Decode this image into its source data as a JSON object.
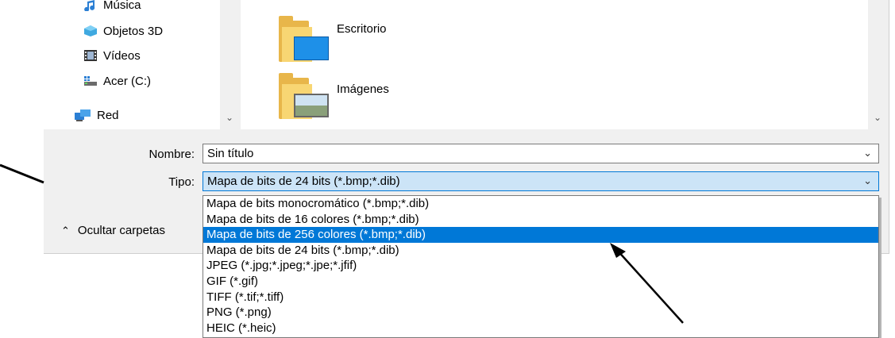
{
  "nav": {
    "items": [
      {
        "label": "Música",
        "icon": "music-icon"
      },
      {
        "label": "Objetos 3D",
        "icon": "cube-icon"
      },
      {
        "label": "Vídeos",
        "icon": "film-icon"
      },
      {
        "label": "Acer (C:)",
        "icon": "drive-icon"
      },
      {
        "label": "Red",
        "icon": "network-icon"
      }
    ]
  },
  "content": {
    "folders": [
      {
        "label": "Escritorio",
        "icon": "desktop-folder-icon"
      },
      {
        "label": "Imágenes",
        "icon": "pictures-folder-icon"
      }
    ]
  },
  "form": {
    "name_label": "Nombre:",
    "name_value": "Sin título",
    "type_label": "Tipo:",
    "type_value": "Mapa de bits de 24 bits (*.bmp;*.dib)"
  },
  "hide_folders_label": "Ocultar carpetas",
  "type_options": [
    "Mapa de bits monocromático (*.bmp;*.dib)",
    "Mapa de bits de 16 colores (*.bmp;*.dib)",
    "Mapa de bits de 256 colores (*.bmp;*.dib)",
    "Mapa de bits de 24 bits (*.bmp;*.dib)",
    "JPEG (*.jpg;*.jpeg;*.jpe;*.jfif)",
    "GIF (*.gif)",
    "TIFF (*.tif;*.tiff)",
    "PNG (*.png)",
    "HEIC (*.heic)"
  ],
  "highlighted_option": 2,
  "colors": {
    "selection": "#0078d7",
    "selected_field": "#cce4f7",
    "folder": "#f8d673"
  }
}
